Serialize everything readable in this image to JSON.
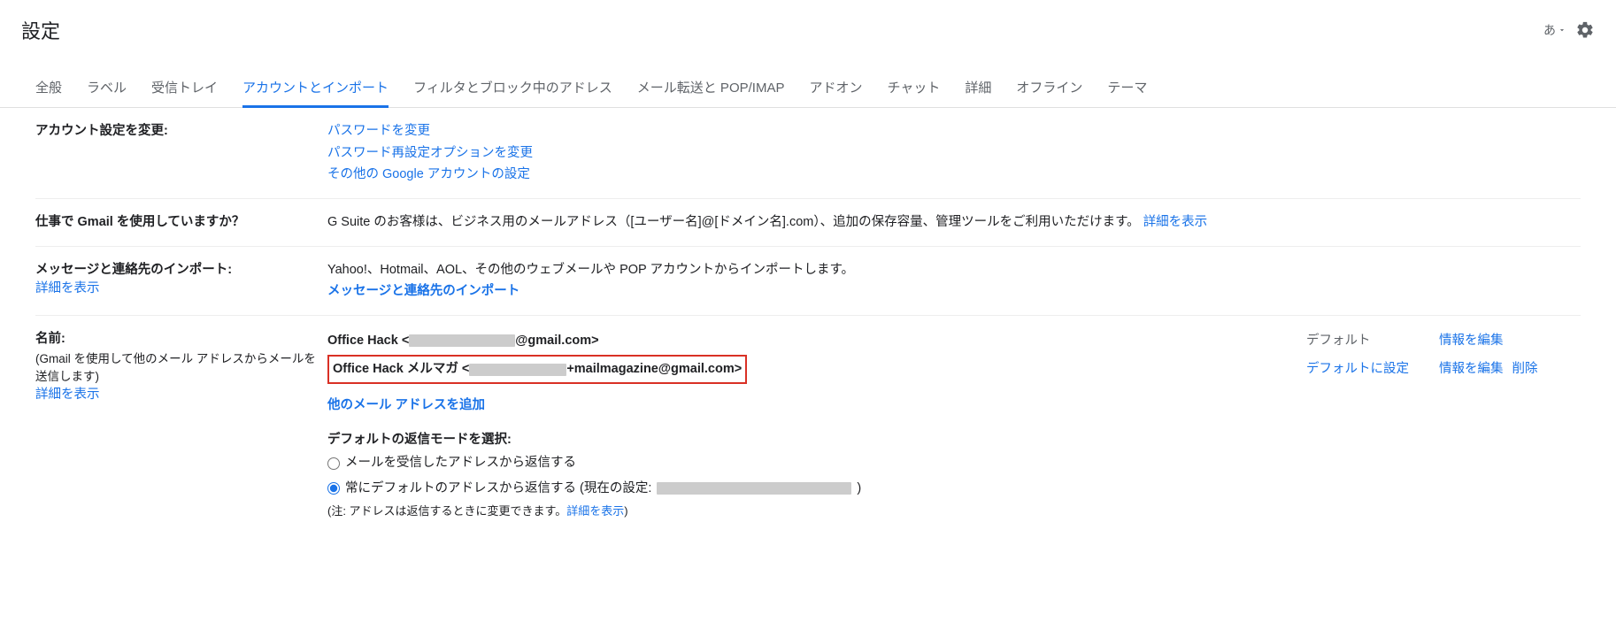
{
  "header": {
    "title": "設定",
    "lang": "あ"
  },
  "tabs": [
    {
      "label": "全般",
      "active": false
    },
    {
      "label": "ラベル",
      "active": false
    },
    {
      "label": "受信トレイ",
      "active": false
    },
    {
      "label": "アカウントとインポート",
      "active": true
    },
    {
      "label": "フィルタとブロック中のアドレス",
      "active": false
    },
    {
      "label": "メール転送と POP/IMAP",
      "active": false
    },
    {
      "label": "アドオン",
      "active": false
    },
    {
      "label": "チャット",
      "active": false
    },
    {
      "label": "詳細",
      "active": false
    },
    {
      "label": "オフライン",
      "active": false
    },
    {
      "label": "テーマ",
      "active": false
    }
  ],
  "sections": {
    "account_change": {
      "title": "アカウント設定を変更:",
      "links": {
        "pw": "パスワードを変更",
        "pw_options": "パスワード再設定オプションを変更",
        "other": "その他の Google アカウントの設定"
      }
    },
    "business": {
      "title": "仕事で Gmail を使用していますか？",
      "text": "G Suite のお客様は、ビジネス用のメールアドレス（[ユーザー名]@[ドメイン名].com）、追加の保存容量、管理ツールをご利用いただけます。",
      "link": "詳細を表示"
    },
    "import": {
      "title": "メッセージと連絡先のインポート:",
      "learn_more": "詳細を表示",
      "text": "Yahoo!、Hotmail、AOL、その他のウェブメールや POP アカウントからインポートします。",
      "action": "メッセージと連絡先のインポート"
    },
    "send_as": {
      "title": "名前:",
      "sub": "(Gmail を使用して他のメール アドレスからメールを送信します)",
      "learn_more": "詳細を表示",
      "rows": {
        "row1": {
          "prefix": "Office Hack <",
          "suffix": "@gmail.com>",
          "default_label": "デフォルト",
          "edit": "情報を編集"
        },
        "row2": {
          "prefix": "Office Hack メルマガ <",
          "suffix": "+mailmagazine@gmail.com>",
          "make_default": "デフォルトに設定",
          "edit": "情報を編集",
          "delete": "削除"
        }
      },
      "add_another": "他のメール アドレスを追加",
      "reply_mode": {
        "title": "デフォルトの返信モードを選択:",
        "opt1": "メールを受信したアドレスから返信する",
        "opt2_pre": "常にデフォルトのアドレスから返信する (現在の設定: ",
        "opt2_post": ")",
        "note_pre": "(注: アドレスは返信するときに変更できます。",
        "note_link": "詳細を表示",
        "note_post": ")"
      }
    }
  }
}
